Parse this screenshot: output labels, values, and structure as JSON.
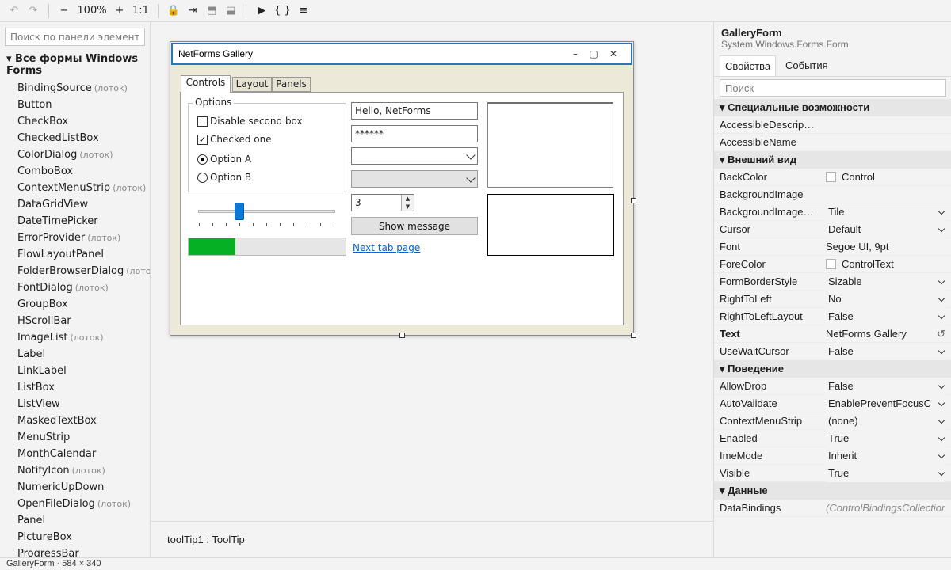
{
  "toolbar": {
    "undo": "↶",
    "redo": "↷",
    "zoom_out": "−",
    "zoom": "100%",
    "zoom_in": "+",
    "actual_size": "1:1",
    "lock": "🔒",
    "tab_order": "⇥",
    "align_top": "⬒",
    "align_bottom": "⬓",
    "run": "▶",
    "code": "{ }",
    "menu": "≡"
  },
  "toolbox": {
    "search_placeholder": "Поиск по панели элементов",
    "group_label": "▾ Все формы Windows Forms",
    "items": [
      {
        "label": "BindingSource",
        "tray": "(лоток)"
      },
      {
        "label": "Button",
        "tray": ""
      },
      {
        "label": "CheckBox",
        "tray": ""
      },
      {
        "label": "CheckedListBox",
        "tray": ""
      },
      {
        "label": "ColorDialog",
        "tray": "(лоток)"
      },
      {
        "label": "ComboBox",
        "tray": ""
      },
      {
        "label": "ContextMenuStrip",
        "tray": "(лоток)"
      },
      {
        "label": "DataGridView",
        "tray": ""
      },
      {
        "label": "DateTimePicker",
        "tray": ""
      },
      {
        "label": "ErrorProvider",
        "tray": "(лоток)"
      },
      {
        "label": "FlowLayoutPanel",
        "tray": ""
      },
      {
        "label": "FolderBrowserDialog",
        "tray": "(лоток)"
      },
      {
        "label": "FontDialog",
        "tray": "(лоток)"
      },
      {
        "label": "GroupBox",
        "tray": ""
      },
      {
        "label": "HScrollBar",
        "tray": ""
      },
      {
        "label": "ImageList",
        "tray": "(лоток)"
      },
      {
        "label": "Label",
        "tray": ""
      },
      {
        "label": "LinkLabel",
        "tray": ""
      },
      {
        "label": "ListBox",
        "tray": ""
      },
      {
        "label": "ListView",
        "tray": ""
      },
      {
        "label": "MaskedTextBox",
        "tray": ""
      },
      {
        "label": "MenuStrip",
        "tray": ""
      },
      {
        "label": "MonthCalendar",
        "tray": ""
      },
      {
        "label": "NotifyIcon",
        "tray": "(лоток)"
      },
      {
        "label": "NumericUpDown",
        "tray": ""
      },
      {
        "label": "OpenFileDialog",
        "tray": "(лоток)"
      },
      {
        "label": "Panel",
        "tray": ""
      },
      {
        "label": "PictureBox",
        "tray": ""
      },
      {
        "label": "ProgressBar",
        "tray": ""
      }
    ]
  },
  "form": {
    "title": "NetForms Gallery",
    "minimize": "–",
    "maximize": "▢",
    "close": "✕",
    "tabs": [
      "Controls",
      "Layout",
      "Panels"
    ],
    "groupbox_label": "Options",
    "checkbox1_label": "Disable second box",
    "checkbox1_checked": false,
    "checkbox2_label": "Checked one",
    "checkbox2_checked": true,
    "radio1_label": "Option A",
    "radio1_selected": true,
    "radio2_label": "Option B",
    "radio2_selected": false,
    "trackbar_value_fraction": 0.3,
    "progress_fraction": 0.3,
    "textbox_value": "Hello, NetForms",
    "password_value": "******",
    "combo1_value": "",
    "combo2_value": "",
    "numeric_value": "3",
    "spin_up": "▲",
    "spin_down": "▼",
    "show_button": "Show message",
    "link_label": "Next tab page"
  },
  "tray": {
    "item": "toolTip1 : ToolTip"
  },
  "properties": {
    "object_name": "GalleryForm",
    "object_type": "System.Windows.Forms.Form",
    "tabs": [
      "Свойства",
      "События"
    ],
    "search_placeholder": "Поиск",
    "categories": [
      {
        "label": "▾ Специальные возможности",
        "rows": [
          {
            "name": "AccessibleDescrip…",
            "value": ""
          },
          {
            "name": "AccessibleName",
            "value": ""
          }
        ]
      },
      {
        "label": "▾ Внешний вид",
        "rows": [
          {
            "name": "BackColor",
            "value": "Control",
            "swatch": "#ffffff"
          },
          {
            "name": "BackgroundImage",
            "value": ""
          },
          {
            "name": "BackgroundImage…",
            "value": "Tile",
            "dropdown": true
          },
          {
            "name": "Cursor",
            "value": "Default",
            "dropdown": true
          },
          {
            "name": "Font",
            "value": "Segoe UI, 9pt"
          },
          {
            "name": "ForeColor",
            "value": "ControlText",
            "swatch": "#ffffff"
          },
          {
            "name": "FormBorderStyle",
            "value": "Sizable",
            "dropdown": true
          },
          {
            "name": "RightToLeft",
            "value": "No",
            "dropdown": true
          },
          {
            "name": "RightToLeftLayout",
            "value": "False",
            "dropdown": true
          },
          {
            "name": "Text",
            "value": "NetForms Gallery",
            "bold": true,
            "reset": "↺"
          },
          {
            "name": "UseWaitCursor",
            "value": "False",
            "dropdown": true
          }
        ]
      },
      {
        "label": "▾ Поведение",
        "rows": [
          {
            "name": "AllowDrop",
            "value": "False",
            "dropdown": true
          },
          {
            "name": "AutoValidate",
            "value": "EnablePreventFocusC",
            "dropdown": true
          },
          {
            "name": "ContextMenuStrip",
            "value": "(none)",
            "dropdown": true
          },
          {
            "name": "Enabled",
            "value": "True",
            "dropdown": true
          },
          {
            "name": "ImeMode",
            "value": "Inherit",
            "dropdown": true
          },
          {
            "name": "Visible",
            "value": "True",
            "dropdown": true
          }
        ]
      },
      {
        "label": "▾ Данные",
        "rows": [
          {
            "name": "DataBindings",
            "value": "(ControlBindingsCollection)",
            "grey": true
          }
        ]
      }
    ]
  },
  "status": {
    "text": "GalleryForm · 584 × 340"
  },
  "colors": {
    "accent": "#0a78d7",
    "progress": "#06b025",
    "titlebar_border": "#2f75b5",
    "link": "#0066cc"
  }
}
